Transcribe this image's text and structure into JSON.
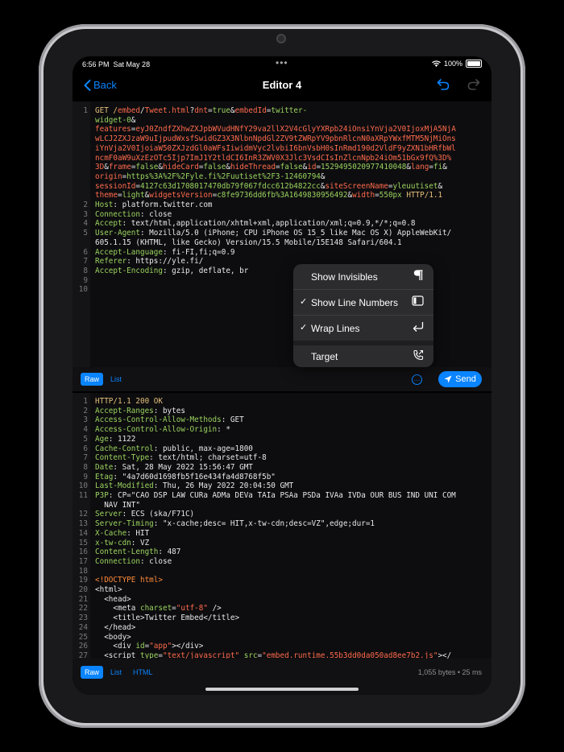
{
  "status": {
    "time": "6:56 PM",
    "date": "Sat May 28",
    "battery": "100%"
  },
  "nav": {
    "back": "Back",
    "title": "Editor 4"
  },
  "request_lines": [
    {
      "n": "1",
      "segs": [
        [
          "GET /",
          "k"
        ],
        [
          "embed",
          "r"
        ],
        [
          "/",
          "w"
        ],
        [
          "Tweet.html",
          "r"
        ],
        [
          "?",
          "w"
        ],
        [
          "dnt",
          "r"
        ],
        [
          "=",
          "w"
        ],
        [
          "true",
          "g"
        ],
        [
          "&",
          "w"
        ],
        [
          "embedId",
          "r"
        ],
        [
          "=",
          "w"
        ],
        [
          "twitter-",
          "g"
        ]
      ]
    },
    {
      "n": "",
      "segs": [
        [
          "widget-0",
          "g"
        ],
        [
          "&",
          "w"
        ]
      ]
    },
    {
      "n": "",
      "segs": [
        [
          "features",
          "r"
        ],
        [
          "=",
          "w"
        ],
        [
          "eyJ0ZndfZXhwZXJpbWVudHNfY29va2llX2V4cGlyYXRpb24iOnsiYnVja2V0IjoxMjA5NjA",
          "r"
        ]
      ]
    },
    {
      "n": "",
      "segs": [
        [
          "wLCJ2ZXJzaW9uIjpudWxsfSwidGZ3X3NlbnNpdGl2ZV9tZWRpYV9pbnRlcnN0aXRpYWxfMTM5NjMiOns",
          "r"
        ]
      ]
    },
    {
      "n": "",
      "segs": [
        [
          "iYnVja2V0IjoiaW50ZXJzdGl0aWFsIiwidmVyc2lvbiI6bnVsbH0sInRmd190d2VldF9yZXN1bHRfbWl",
          "r"
        ]
      ]
    },
    {
      "n": "",
      "segs": [
        [
          "ncmF0aW9uXzEzOTc5Ijp7ImJ1Y2tldCI6InR3ZWV0X3Jlc3VsdCIsInZlcnNpb24iOm51bGx9fQ%3D%",
          "r"
        ]
      ]
    },
    {
      "n": "",
      "segs": [
        [
          "3D",
          "r"
        ],
        [
          "&",
          "w"
        ],
        [
          "frame",
          "r"
        ],
        [
          "=",
          "w"
        ],
        [
          "false",
          "g"
        ],
        [
          "&",
          "w"
        ],
        [
          "hideCard",
          "r"
        ],
        [
          "=",
          "w"
        ],
        [
          "false",
          "g"
        ],
        [
          "&",
          "w"
        ],
        [
          "hideThread",
          "r"
        ],
        [
          "=",
          "w"
        ],
        [
          "false",
          "g"
        ],
        [
          "&",
          "w"
        ],
        [
          "id",
          "r"
        ],
        [
          "=",
          "w"
        ],
        [
          "1529495020977410048",
          "g"
        ],
        [
          "&",
          "w"
        ],
        [
          "lang",
          "r"
        ],
        [
          "=",
          "w"
        ],
        [
          "fi",
          "g"
        ],
        [
          "&",
          "w"
        ]
      ]
    },
    {
      "n": "",
      "segs": [
        [
          "origin",
          "r"
        ],
        [
          "=",
          "w"
        ],
        [
          "https%3A%2F%2Fyle.fi%2Fuutiset%2F3-12460794",
          "g"
        ],
        [
          "&",
          "w"
        ]
      ]
    },
    {
      "n": "",
      "segs": [
        [
          "sessionId",
          "r"
        ],
        [
          "=",
          "w"
        ],
        [
          "4127c63d1708017470db79f067fdcc612b4822cc",
          "g"
        ],
        [
          "&",
          "w"
        ],
        [
          "siteScreenName",
          "r"
        ],
        [
          "=",
          "w"
        ],
        [
          "yleuutiset",
          "g"
        ],
        [
          "&",
          "w"
        ]
      ]
    },
    {
      "n": "",
      "segs": [
        [
          "theme",
          "r"
        ],
        [
          "=",
          "w"
        ],
        [
          "light",
          "g"
        ],
        [
          "&",
          "w"
        ],
        [
          "widgetsVersion",
          "r"
        ],
        [
          "=",
          "w"
        ],
        [
          "c8fe9736dd6fb%3A1649830956492",
          "g"
        ],
        [
          "&",
          "w"
        ],
        [
          "width",
          "r"
        ],
        [
          "=",
          "w"
        ],
        [
          "550px",
          "g"
        ],
        [
          " HTTP/1.1",
          "k"
        ]
      ]
    },
    {
      "n": "2",
      "segs": [
        [
          "Host",
          "g"
        ],
        [
          ": platform.twitter.com",
          "w"
        ]
      ]
    },
    {
      "n": "3",
      "segs": [
        [
          "Connection",
          "g"
        ],
        [
          ": close",
          "w"
        ]
      ]
    },
    {
      "n": "4",
      "segs": [
        [
          "Accept",
          "g"
        ],
        [
          ": text/html,application/xhtml+xml,application/xml;q=0.9,*/*;q=0.8",
          "w"
        ]
      ]
    },
    {
      "n": "5",
      "segs": [
        [
          "User-Agent",
          "g"
        ],
        [
          ": Mozilla/5.0 (iPhone; CPU iPhone OS 15_5 like Mac OS X) AppleWebKit/",
          "w"
        ]
      ]
    },
    {
      "n": "",
      "segs": [
        [
          "605.1.15 (KHTML, like Gecko) Version/15.5 Mobile/15E148 Safari/604.1",
          "w"
        ]
      ]
    },
    {
      "n": "6",
      "segs": [
        [
          "Accept-Language",
          "g"
        ],
        [
          ": fi-FI,fi;q=0.9",
          "w"
        ]
      ]
    },
    {
      "n": "7",
      "segs": [
        [
          "Referer",
          "g"
        ],
        [
          ": https://yle.fi/",
          "w"
        ]
      ]
    },
    {
      "n": "8",
      "segs": [
        [
          "Accept-Encoding",
          "g"
        ],
        [
          ": gzip, deflate, br",
          "w"
        ]
      ]
    },
    {
      "n": "9",
      "segs": []
    },
    {
      "n": "10",
      "segs": []
    }
  ],
  "menu": {
    "items": [
      {
        "check": "",
        "label": "Show Invisibles",
        "icon": "pilcrow-icon"
      },
      {
        "check": "✓",
        "label": "Show Line Numbers",
        "icon": "sidebar-icon"
      },
      {
        "check": "✓",
        "label": "Wrap Lines",
        "icon": "return-arrow-icon"
      },
      {
        "check": "",
        "label": "Target",
        "icon": "phone-arrow-icon"
      }
    ]
  },
  "midbar": {
    "raw": "Raw",
    "list": "List",
    "more": "…",
    "send": "Send"
  },
  "response_lines": [
    {
      "n": "1",
      "segs": [
        [
          "HTTP/1.1 200 OK",
          "k"
        ]
      ]
    },
    {
      "n": "2",
      "segs": [
        [
          "Accept-Ranges",
          "g"
        ],
        [
          ": bytes",
          "w"
        ]
      ]
    },
    {
      "n": "3",
      "segs": [
        [
          "Access-Control-Allow-Methods",
          "g"
        ],
        [
          ": GET",
          "w"
        ]
      ]
    },
    {
      "n": "4",
      "segs": [
        [
          "Access-Control-Allow-Origin",
          "g"
        ],
        [
          ": *",
          "w"
        ]
      ]
    },
    {
      "n": "5",
      "segs": [
        [
          "Age",
          "g"
        ],
        [
          ": 1122",
          "w"
        ]
      ]
    },
    {
      "n": "6",
      "segs": [
        [
          "Cache-Control",
          "g"
        ],
        [
          ": public, max-age=1800",
          "w"
        ]
      ]
    },
    {
      "n": "7",
      "segs": [
        [
          "Content-Type",
          "g"
        ],
        [
          ": text/html; charset=utf-8",
          "w"
        ]
      ]
    },
    {
      "n": "8",
      "segs": [
        [
          "Date",
          "g"
        ],
        [
          ": Sat, 28 May 2022 15:56:47 GMT",
          "w"
        ]
      ]
    },
    {
      "n": "9",
      "segs": [
        [
          "Etag",
          "g"
        ],
        [
          ": \"4a7d60d1698fb5f16e434fa4d8768f5b\"",
          "w"
        ]
      ]
    },
    {
      "n": "10",
      "segs": [
        [
          "Last-Modified",
          "g"
        ],
        [
          ": Thu, 26 May 2022 20:04:50 GMT",
          "w"
        ]
      ]
    },
    {
      "n": "11",
      "segs": [
        [
          "P3P",
          "g"
        ],
        [
          ": CP=\"CAO DSP LAW CURa ADMa DEVa TAIa PSAa PSDa IVAa IVDa OUR BUS IND UNI COM",
          "w"
        ]
      ]
    },
    {
      "n": "",
      "segs": [
        [
          "  NAV INT\"",
          "w"
        ]
      ]
    },
    {
      "n": "12",
      "segs": [
        [
          "Server",
          "g"
        ],
        [
          ": ECS (ska/F71C)",
          "w"
        ]
      ]
    },
    {
      "n": "13",
      "segs": [
        [
          "Server-Timing",
          "g"
        ],
        [
          ": \"x-cache;desc= HIT,x-tw-cdn;desc=VZ\",edge;dur=1",
          "w"
        ]
      ]
    },
    {
      "n": "14",
      "segs": [
        [
          "X-Cache",
          "g"
        ],
        [
          ": HIT",
          "w"
        ]
      ]
    },
    {
      "n": "15",
      "segs": [
        [
          "x-tw-cdn",
          "g"
        ],
        [
          ": VZ",
          "w"
        ]
      ]
    },
    {
      "n": "16",
      "segs": [
        [
          "Content-Length",
          "g"
        ],
        [
          ": 487",
          "w"
        ]
      ]
    },
    {
      "n": "17",
      "segs": [
        [
          "Connection",
          "g"
        ],
        [
          ": close",
          "w"
        ]
      ]
    },
    {
      "n": "18",
      "segs": []
    },
    {
      "n": "19",
      "segs": [
        [
          "<!DOCTYPE html>",
          "o"
        ]
      ]
    },
    {
      "n": "20",
      "segs": [
        [
          "<html>",
          "w"
        ]
      ]
    },
    {
      "n": "21",
      "segs": [
        [
          "  <head>",
          "w"
        ]
      ]
    },
    {
      "n": "22",
      "segs": [
        [
          "    <meta ",
          "w"
        ],
        [
          "charset",
          "g"
        ],
        [
          "=",
          "w"
        ],
        [
          "\"utf-8\"",
          "r"
        ],
        [
          " />",
          "w"
        ]
      ]
    },
    {
      "n": "23",
      "segs": [
        [
          "    <title>Twitter Embed</title>",
          "w"
        ]
      ]
    },
    {
      "n": "24",
      "segs": [
        [
          "  </head>",
          "w"
        ]
      ]
    },
    {
      "n": "25",
      "segs": [
        [
          "  <body>",
          "w"
        ]
      ]
    },
    {
      "n": "26",
      "segs": [
        [
          "    <div ",
          "w"
        ],
        [
          "id",
          "g"
        ],
        [
          "=",
          "w"
        ],
        [
          "\"app\"",
          "r"
        ],
        [
          "></div>",
          "w"
        ]
      ]
    },
    {
      "n": "27",
      "segs": [
        [
          "  <script ",
          "w"
        ],
        [
          "type",
          "g"
        ],
        [
          "=",
          "w"
        ],
        [
          "\"text/javascript\"",
          "r"
        ],
        [
          " src",
          "g"
        ],
        [
          "=",
          "w"
        ],
        [
          "\"embed.runtime.55b3dd0da050ad8ee7b2.js\"",
          "r"
        ],
        [
          "></",
          "w"
        ]
      ]
    }
  ],
  "bottombar": {
    "raw": "Raw",
    "list": "List",
    "html": "HTML",
    "info": "1,055 bytes • 25 ms"
  }
}
